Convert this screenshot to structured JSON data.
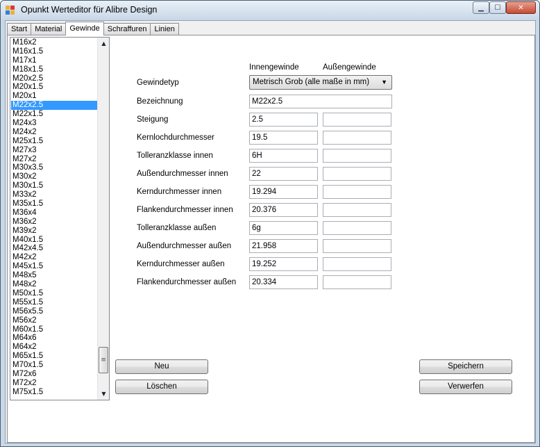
{
  "window": {
    "title": "Opunkt Werteditor für Alibre Design"
  },
  "tabs": [
    "Start",
    "Material",
    "Gewinde",
    "Schraffuren",
    "Linien"
  ],
  "active_tab": "Gewinde",
  "thread_list": {
    "items": [
      "M16x2",
      "M16x1.5",
      "M17x1",
      "M18x1.5",
      "M20x2.5",
      "M20x1.5",
      "M20x1",
      "M22x2.5",
      "M22x1.5",
      "M24x3",
      "M24x2",
      "M25x1.5",
      "M27x3",
      "M27x2",
      "M30x3.5",
      "M30x2",
      "M30x1.5",
      "M33x2",
      "M35x1.5",
      "M36x4",
      "M36x2",
      "M39x2",
      "M40x1.5",
      "M42x4.5",
      "M42x2",
      "M45x1.5",
      "M48x5",
      "M48x2",
      "M50x1.5",
      "M55x1.5",
      "M56x5.5",
      "M56x2",
      "M60x1.5",
      "M64x6",
      "M64x2",
      "M65x1.5",
      "M70x1.5",
      "M72x6",
      "M72x2",
      "M75x1.5"
    ],
    "selected": "M22x2.5"
  },
  "columns": {
    "inner": "Innengewinde",
    "outer": "Außengewinde"
  },
  "form": {
    "gewindetyp": {
      "label": "Gewindetyp",
      "value": "Metrisch Grob (alle maße in mm)"
    },
    "bezeichnung": {
      "label": "Bezeichnung",
      "value": "M22x2.5"
    },
    "rows": [
      {
        "label": "Steigung",
        "inner": "2.5",
        "outer": ""
      },
      {
        "label": "Kernlochdurchmesser",
        "inner": "19.5",
        "outer": ""
      },
      {
        "label": "Tolleranzklasse innen",
        "inner": "6H",
        "outer": ""
      },
      {
        "label": "Außendurchmesser innen",
        "inner": "22",
        "outer": ""
      },
      {
        "label": "Kerndurchmesser innen",
        "inner": "19.294",
        "outer": ""
      },
      {
        "label": "Flankendurchmesser innen",
        "inner": "20.376",
        "outer": ""
      },
      {
        "label": "Tolleranzklasse außen",
        "inner": "6g",
        "outer": ""
      },
      {
        "label": "Außendurchmesser außen",
        "inner": "21.958",
        "outer": ""
      },
      {
        "label": "Kerndurchmesser außen",
        "inner": "19.252",
        "outer": ""
      },
      {
        "label": "Flankendurchmesser außen",
        "inner": "20.334",
        "outer": ""
      }
    ]
  },
  "buttons": {
    "neu": "Neu",
    "loeschen": "Löschen",
    "speichern": "Speichern",
    "verwerfen": "Verwerfen"
  }
}
